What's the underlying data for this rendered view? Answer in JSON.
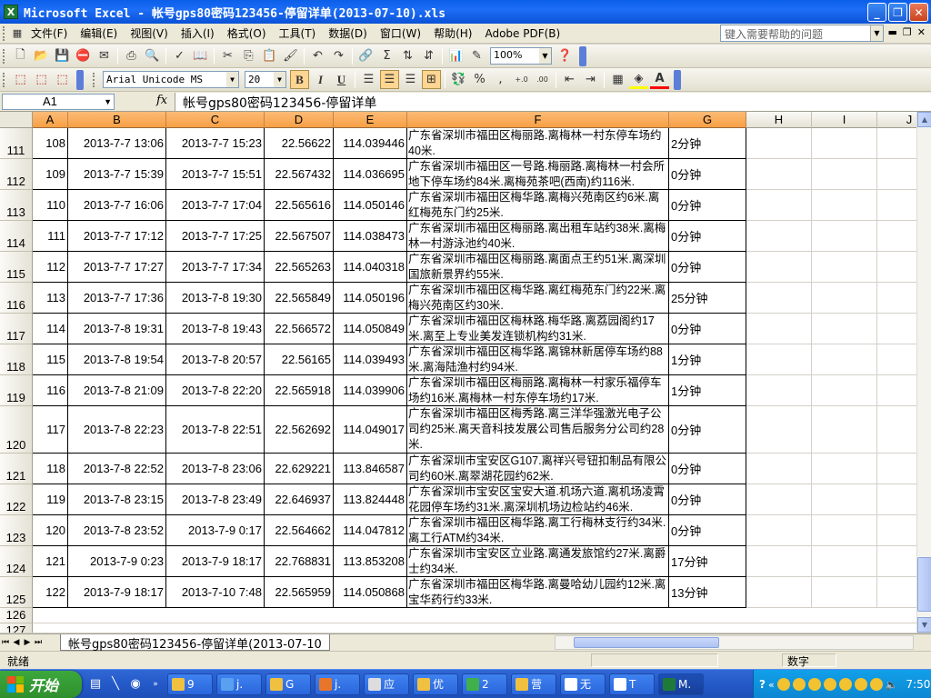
{
  "window": {
    "title": "Microsoft Excel - 帐号gps80密码123456-停留详单(2013-07-10).xls",
    "app_icon": "X"
  },
  "menu": {
    "items": [
      "文件(F)",
      "编辑(E)",
      "视图(V)",
      "插入(I)",
      "格式(O)",
      "工具(T)",
      "数据(D)",
      "窗口(W)",
      "帮助(H)",
      "Adobe PDF(B)"
    ],
    "help_placeholder": "键入需要帮助的问题"
  },
  "toolbar": {
    "zoom": "100%",
    "font_name": "Arial Unicode MS",
    "font_size": "20",
    "bold": "B",
    "italic": "I",
    "underline": "U",
    "sigma": "Σ",
    "percent": "%",
    "comma": ",",
    "font_color_label": "A",
    "undo": "↶",
    "redo": "↷",
    "increase_decimal": "+.0",
    "decrease_decimal": ".00"
  },
  "formula_bar": {
    "name_box": "A1",
    "fx_label": "fx",
    "content": "帐号gps80密码123456-停留详单"
  },
  "grid": {
    "columns": [
      "A",
      "B",
      "C",
      "D",
      "E",
      "F",
      "G",
      "H",
      "I",
      "J"
    ],
    "rows": [
      {
        "rownum": "111",
        "A": "108",
        "B": "2013-7-7 13:06",
        "C": "2013-7-7 15:23",
        "D": "22.56622",
        "E": "114.039446",
        "F": "广东省深圳市福田区梅丽路.离梅林一村东停车场约40米.",
        "G": "2分钟"
      },
      {
        "rownum": "112",
        "A": "109",
        "B": "2013-7-7 15:39",
        "C": "2013-7-7 15:51",
        "D": "22.567432",
        "E": "114.036695",
        "F": "广东省深圳市福田区一号路.梅丽路.离梅林一村会所地下停车场约84米.离梅苑茶吧(西南)约116米.",
        "G": "0分钟"
      },
      {
        "rownum": "113",
        "A": "110",
        "B": "2013-7-7 16:06",
        "C": "2013-7-7 17:04",
        "D": "22.565616",
        "E": "114.050146",
        "F": "广东省深圳市福田区梅华路.离梅兴苑南区约6米.离红梅苑东门约25米.",
        "G": "0分钟"
      },
      {
        "rownum": "114",
        "A": "111",
        "B": "2013-7-7 17:12",
        "C": "2013-7-7 17:25",
        "D": "22.567507",
        "E": "114.038473",
        "F": "广东省深圳市福田区梅丽路.离出租车站约38米.离梅林一村游泳池约40米.",
        "G": "0分钟"
      },
      {
        "rownum": "115",
        "A": "112",
        "B": "2013-7-7 17:27",
        "C": "2013-7-7 17:34",
        "D": "22.565263",
        "E": "114.040318",
        "F": "广东省深圳市福田区梅丽路.离面点王约51米.离深圳国旅新景界约55米.",
        "G": "0分钟"
      },
      {
        "rownum": "116",
        "A": "113",
        "B": "2013-7-7 17:36",
        "C": "2013-7-8 19:30",
        "D": "22.565849",
        "E": "114.050196",
        "F": "广东省深圳市福田区梅华路.离红梅苑东门约22米.离梅兴苑南区约30米.",
        "G": "25分钟"
      },
      {
        "rownum": "117",
        "A": "114",
        "B": "2013-7-8 19:31",
        "C": "2013-7-8 19:43",
        "D": "22.566572",
        "E": "114.050849",
        "F": "广东省深圳市福田区梅林路.梅华路.离荔园阁约17米.离至上专业美发连锁机构约31米.",
        "G": "0分钟"
      },
      {
        "rownum": "118",
        "A": "115",
        "B": "2013-7-8 19:54",
        "C": "2013-7-8 20:57",
        "D": "22.56165",
        "E": "114.039493",
        "F": "广东省深圳市福田区梅华路.离锦林新居停车场约88米.离海陆渔村约94米.",
        "G": "1分钟"
      },
      {
        "rownum": "119",
        "A": "116",
        "B": "2013-7-8 21:09",
        "C": "2013-7-8 22:20",
        "D": "22.565918",
        "E": "114.039906",
        "F": "广东省深圳市福田区梅丽路.离梅林一村家乐福停车场约16米.离梅林一村东停车场约17米.",
        "G": "1分钟"
      },
      {
        "rownum": "120",
        "A": "117",
        "B": "2013-7-8 22:23",
        "C": "2013-7-8 22:51",
        "D": "22.562692",
        "E": "114.049017",
        "F": "广东省深圳市福田区梅秀路.离三洋华强激光电子公司约25米.离天音科技发展公司售后服务分公司约28米.",
        "G": "0分钟"
      },
      {
        "rownum": "121",
        "A": "118",
        "B": "2013-7-8 22:52",
        "C": "2013-7-8 23:06",
        "D": "22.629221",
        "E": "113.846587",
        "F": "广东省深圳市宝安区G107.离祥兴号钮扣制品有限公司约60米.离翠湖花园约62米.",
        "G": "0分钟"
      },
      {
        "rownum": "122",
        "A": "119",
        "B": "2013-7-8 23:15",
        "C": "2013-7-8 23:49",
        "D": "22.646937",
        "E": "113.824448",
        "F": "广东省深圳市宝安区宝安大道.机场六道.离机场凌霄花园停车场约31米.离深圳机场边检站约46米.",
        "G": "0分钟"
      },
      {
        "rownum": "123",
        "A": "120",
        "B": "2013-7-8 23:52",
        "C": "2013-7-9 0:17",
        "D": "22.564662",
        "E": "114.047812",
        "F": "广东省深圳市福田区梅华路.离工行梅林支行约34米.离工行ATM约34米.",
        "G": "0分钟"
      },
      {
        "rownum": "124",
        "A": "121",
        "B": "2013-7-9 0:23",
        "C": "2013-7-9 18:17",
        "D": "22.768831",
        "E": "113.853208",
        "F": "广东省深圳市宝安区立业路.离通发旅馆约27米.离爵士约34米.",
        "G": "17分钟"
      },
      {
        "rownum": "125",
        "A": "122",
        "B": "2013-7-9 18:17",
        "C": "2013-7-10 7:48",
        "D": "22.565959",
        "E": "114.050868",
        "F": "广东省深圳市福田区梅华路.离曼哈幼儿园约12米.离宝华药行约33米.",
        "G": "13分钟"
      }
    ],
    "empty_rows": [
      "126",
      "127"
    ]
  },
  "sheet_tab": {
    "label": "帐号gps80密码123456-停留详单(2013-07-10"
  },
  "status": {
    "left": "就绪",
    "right": "数字"
  },
  "taskbar": {
    "start_label": "开始",
    "tasks": [
      "9",
      "j.",
      "G",
      "j.",
      "应",
      "优",
      "2",
      "营",
      "无",
      "T",
      "M."
    ],
    "clock": "7:50"
  },
  "colors": {
    "selected_header": "#f7a043",
    "title_blue": "#0a5ee8",
    "taskbar_blue": "#2459c8",
    "start_green": "#3ca83c"
  }
}
